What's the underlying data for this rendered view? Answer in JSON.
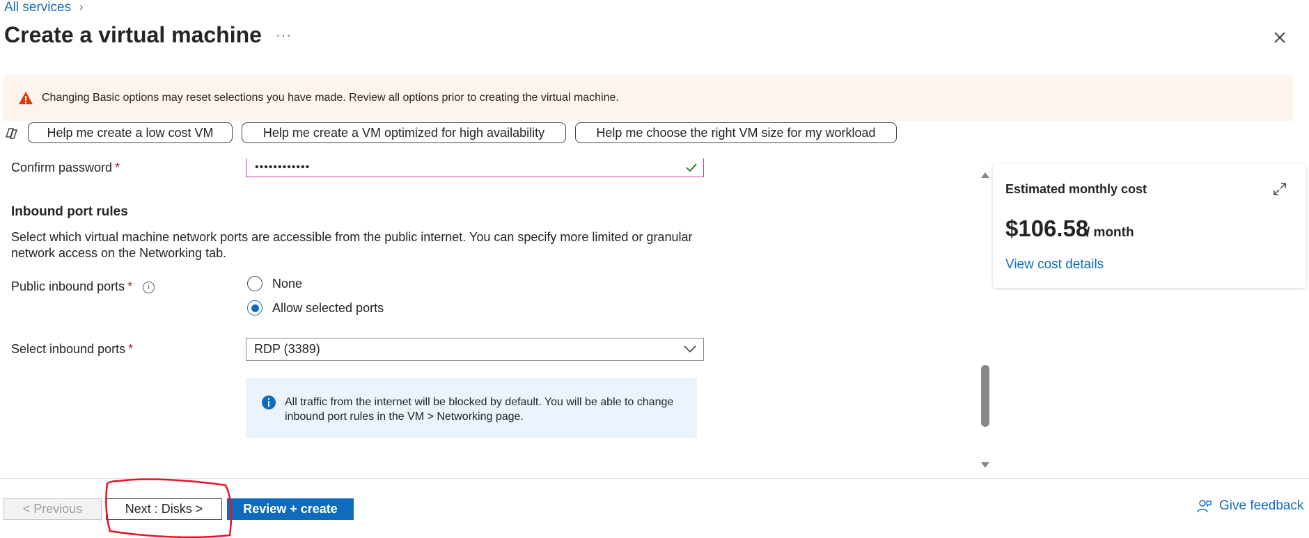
{
  "breadcrumb": {
    "root": "All services"
  },
  "header": {
    "title": "Create a virtual machine",
    "more": "···"
  },
  "warning": {
    "text": "Changing Basic options may reset selections you have made. Review all options prior to creating the virtual machine."
  },
  "copilot": {
    "chips": [
      "Help me create a low cost VM",
      "Help me create a VM optimized for high availability",
      "Help me choose the right VM size for my workload"
    ]
  },
  "form": {
    "confirm_password": {
      "label": "Confirm password",
      "value": "••••••••••••"
    },
    "inbound_section": {
      "title": "Inbound port rules",
      "description": "Select which virtual machine network ports are accessible from the public internet. You can specify more limited or granular network access on the Networking tab."
    },
    "public_inbound": {
      "label": "Public inbound ports",
      "options": [
        "None",
        "Allow selected ports"
      ],
      "selected": "Allow selected ports"
    },
    "select_inbound": {
      "label": "Select inbound ports",
      "value": "RDP (3389)"
    },
    "info": {
      "text": "All traffic from the internet will be blocked by default. You will be able to change inbound port rules in the VM > Networking page."
    },
    "required_mark": "*"
  },
  "cost_card": {
    "title": "Estimated monthly cost",
    "price": "$106.58",
    "per": "/ month",
    "link": "View cost details"
  },
  "footer": {
    "previous": "< Previous",
    "next": "Next : Disks >",
    "review": "Review + create",
    "feedback": "Give feedback"
  },
  "colors": {
    "accent": "#0f6cbd",
    "warning_bg": "#fdf4ee",
    "warning_icon": "#d83b01",
    "annotation": "#e81123"
  },
  "icons": [
    "chevron-right-icon",
    "close-icon",
    "warning-icon",
    "copilot-icon",
    "checkmark-icon",
    "info-icon",
    "chevron-down-icon",
    "expand-icon",
    "feedback-icon"
  ]
}
